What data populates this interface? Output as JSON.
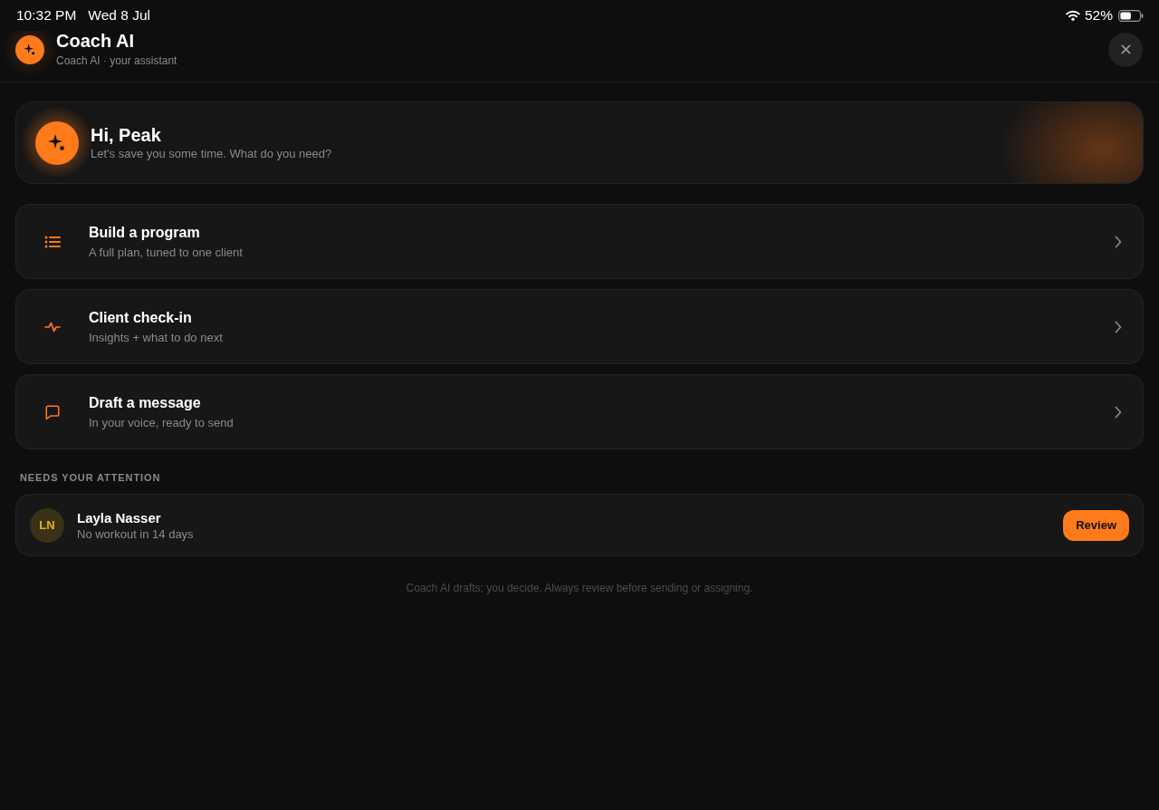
{
  "status_bar": {
    "time": "10:32 PM",
    "date": "Wed 8 Jul",
    "battery": "52%"
  },
  "header": {
    "title": "Coach AI",
    "subtitle": "Coach AI · your assistant"
  },
  "greeting": {
    "title": "Hi, Peak",
    "subtitle": "Let's save you some time. What do you need?"
  },
  "actions": [
    {
      "kind": "list",
      "title": "Build a program",
      "subtitle": "A full plan, tuned to one client"
    },
    {
      "kind": "pulse",
      "title": "Client check-in",
      "subtitle": "Insights + what to do next"
    },
    {
      "kind": "message",
      "title": "Draft a message",
      "subtitle": "In your voice, ready to send"
    }
  ],
  "attention": {
    "title": "NEEDS YOUR ATTENTION",
    "clients": [
      {
        "initials": "LN",
        "name": "Layla Nasser",
        "detail": "No workout in 14 days",
        "action": "Review"
      }
    ]
  },
  "footer": "Coach AI drafts; you decide. Always review before sending or assigning."
}
